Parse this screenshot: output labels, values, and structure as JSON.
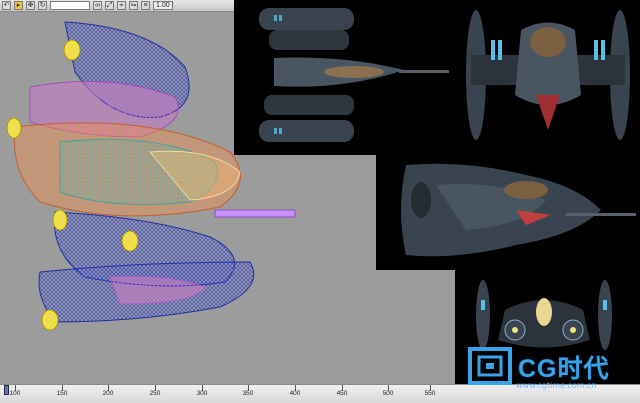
{
  "toolbar": {
    "view_select": "",
    "zoom_label": "1.00"
  },
  "ruler": {
    "labels": [
      "100",
      "150",
      "200",
      "250",
      "300",
      "350",
      "400",
      "450",
      "500",
      "550"
    ]
  },
  "logo": {
    "name": "CG时代",
    "url": "www.cgtime.com.cn"
  },
  "colors": {
    "viewport_bg": "#9c9c9c",
    "render_bg": "#000000",
    "logo_blue": "#3aa3e8"
  },
  "icons": [
    "select-icon",
    "move-icon",
    "rotate-icon",
    "scale-icon",
    "link-icon"
  ]
}
